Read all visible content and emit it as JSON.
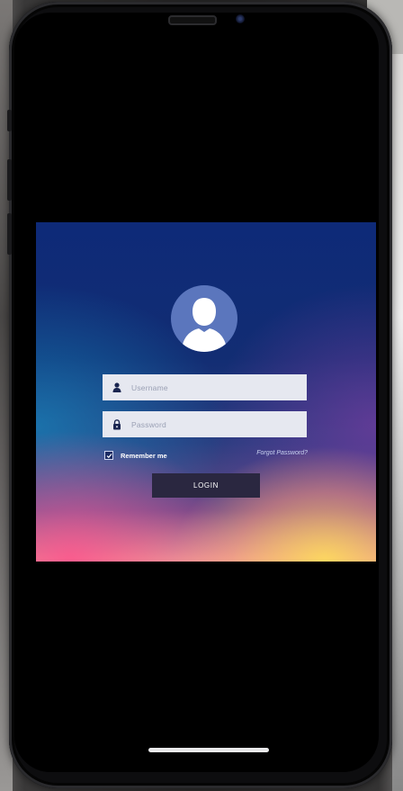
{
  "login_screen": {
    "username": {
      "placeholder": "Username",
      "icon": "user-icon"
    },
    "password": {
      "placeholder": "Password",
      "icon": "lock-icon"
    },
    "remember_me": {
      "label": "Remember me",
      "checked": true
    },
    "forgot_password": "Forgot Password?",
    "login_button": "LOGIN",
    "avatar": {
      "icon": "user-avatar-icon",
      "color": "#5b76bd"
    }
  },
  "colors": {
    "background_top": "#0e2a78",
    "input_background": "#e6e8f0",
    "button_background": "#2a2740"
  }
}
